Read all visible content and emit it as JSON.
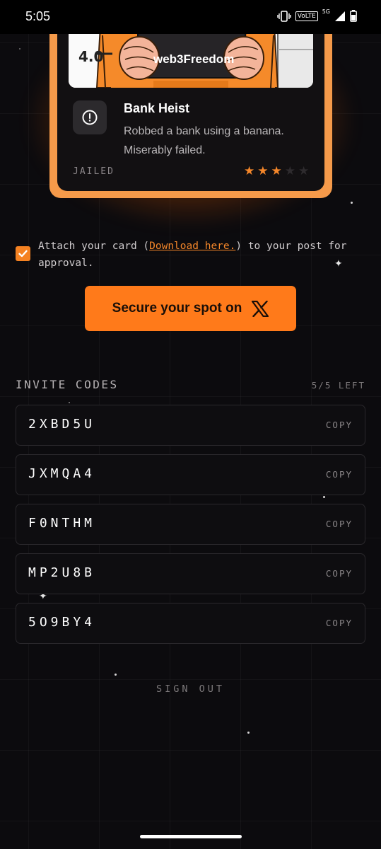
{
  "status_bar": {
    "time": "5:05",
    "volte": "VoLTE",
    "network": "5G"
  },
  "card": {
    "score": "4.0",
    "image_text": "web3Freedom",
    "title": "Bank Heist",
    "description": "Robbed a bank using a banana. Miserably failed.",
    "status": "JAILED",
    "rating": 3,
    "max_rating": 5
  },
  "consent": {
    "before": "Attach your card (",
    "link": "Download here.",
    "after": ") to your post for approval."
  },
  "cta": {
    "label": "Secure your spot on",
    "icon": "x-logo-icon"
  },
  "invites": {
    "title": "INVITE CODES",
    "count": "5/5 LEFT",
    "copy_label": "COPY",
    "codes": [
      "2XBD5U",
      "JXMQA4",
      "F0NTHM",
      "MP2U8B",
      "5O9BY4"
    ]
  },
  "signout": "SIGN OUT",
  "colors": {
    "accent": "#ff7a1a",
    "background": "#0c0b0e",
    "card_border": "#f59a4a"
  }
}
